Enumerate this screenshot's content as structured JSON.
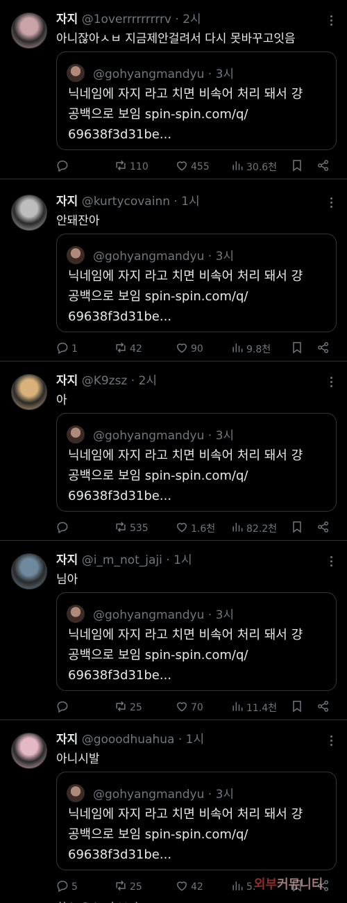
{
  "quoted": {
    "handle": "@gohyangmandyu",
    "time": "3시",
    "text_line1": "닉네임에 자지 라고 치면 비속어 처리 돼서 걍",
    "text_line2": "공백으로 보임 spin-spin.com/q/",
    "text_line3": "69638f3d31be..."
  },
  "tweets": [
    {
      "name": "자지",
      "handle": "@1overrrrrrrrrv",
      "time": "2시",
      "text": "아니잖아ㅅㅂ 지금제안걸려서 다시 못바꾸고잇음",
      "replies": "",
      "retweets": "110",
      "likes": "455",
      "views": "30.6천",
      "avatar_color": "#c9a3a8"
    },
    {
      "name": "자지",
      "handle": "@kurtycovainn",
      "time": "1시",
      "text": "안돼잔아",
      "replies": "1",
      "retweets": "42",
      "likes": "90",
      "views": "9.8천",
      "avatar_color": "#bdbdbd"
    },
    {
      "name": "자지",
      "handle": "@K9zsz",
      "time": "2시",
      "text": "아",
      "replies": "",
      "retweets": "535",
      "likes": "1.6천",
      "views": "82.2천",
      "avatar_color": "#d8b27a"
    },
    {
      "name": "자지",
      "handle": "@i_m_not_jaji",
      "time": "1시",
      "text": "님아",
      "replies": "",
      "retweets": "25",
      "likes": "70",
      "views": "11.4천",
      "avatar_color": "#6f8a9e"
    },
    {
      "name": "자지",
      "handle": "@gooodhuahua",
      "time": "1시",
      "text": "아니시발",
      "replies": "5",
      "retweets": "25",
      "likes": "42",
      "views": "5.",
      "avatar_color": "#e5b8c6"
    }
  ],
  "watermark": {
    "part1": "외부",
    "part2": "커뮤니티"
  },
  "cut_text": "최소 요소 더 보기"
}
